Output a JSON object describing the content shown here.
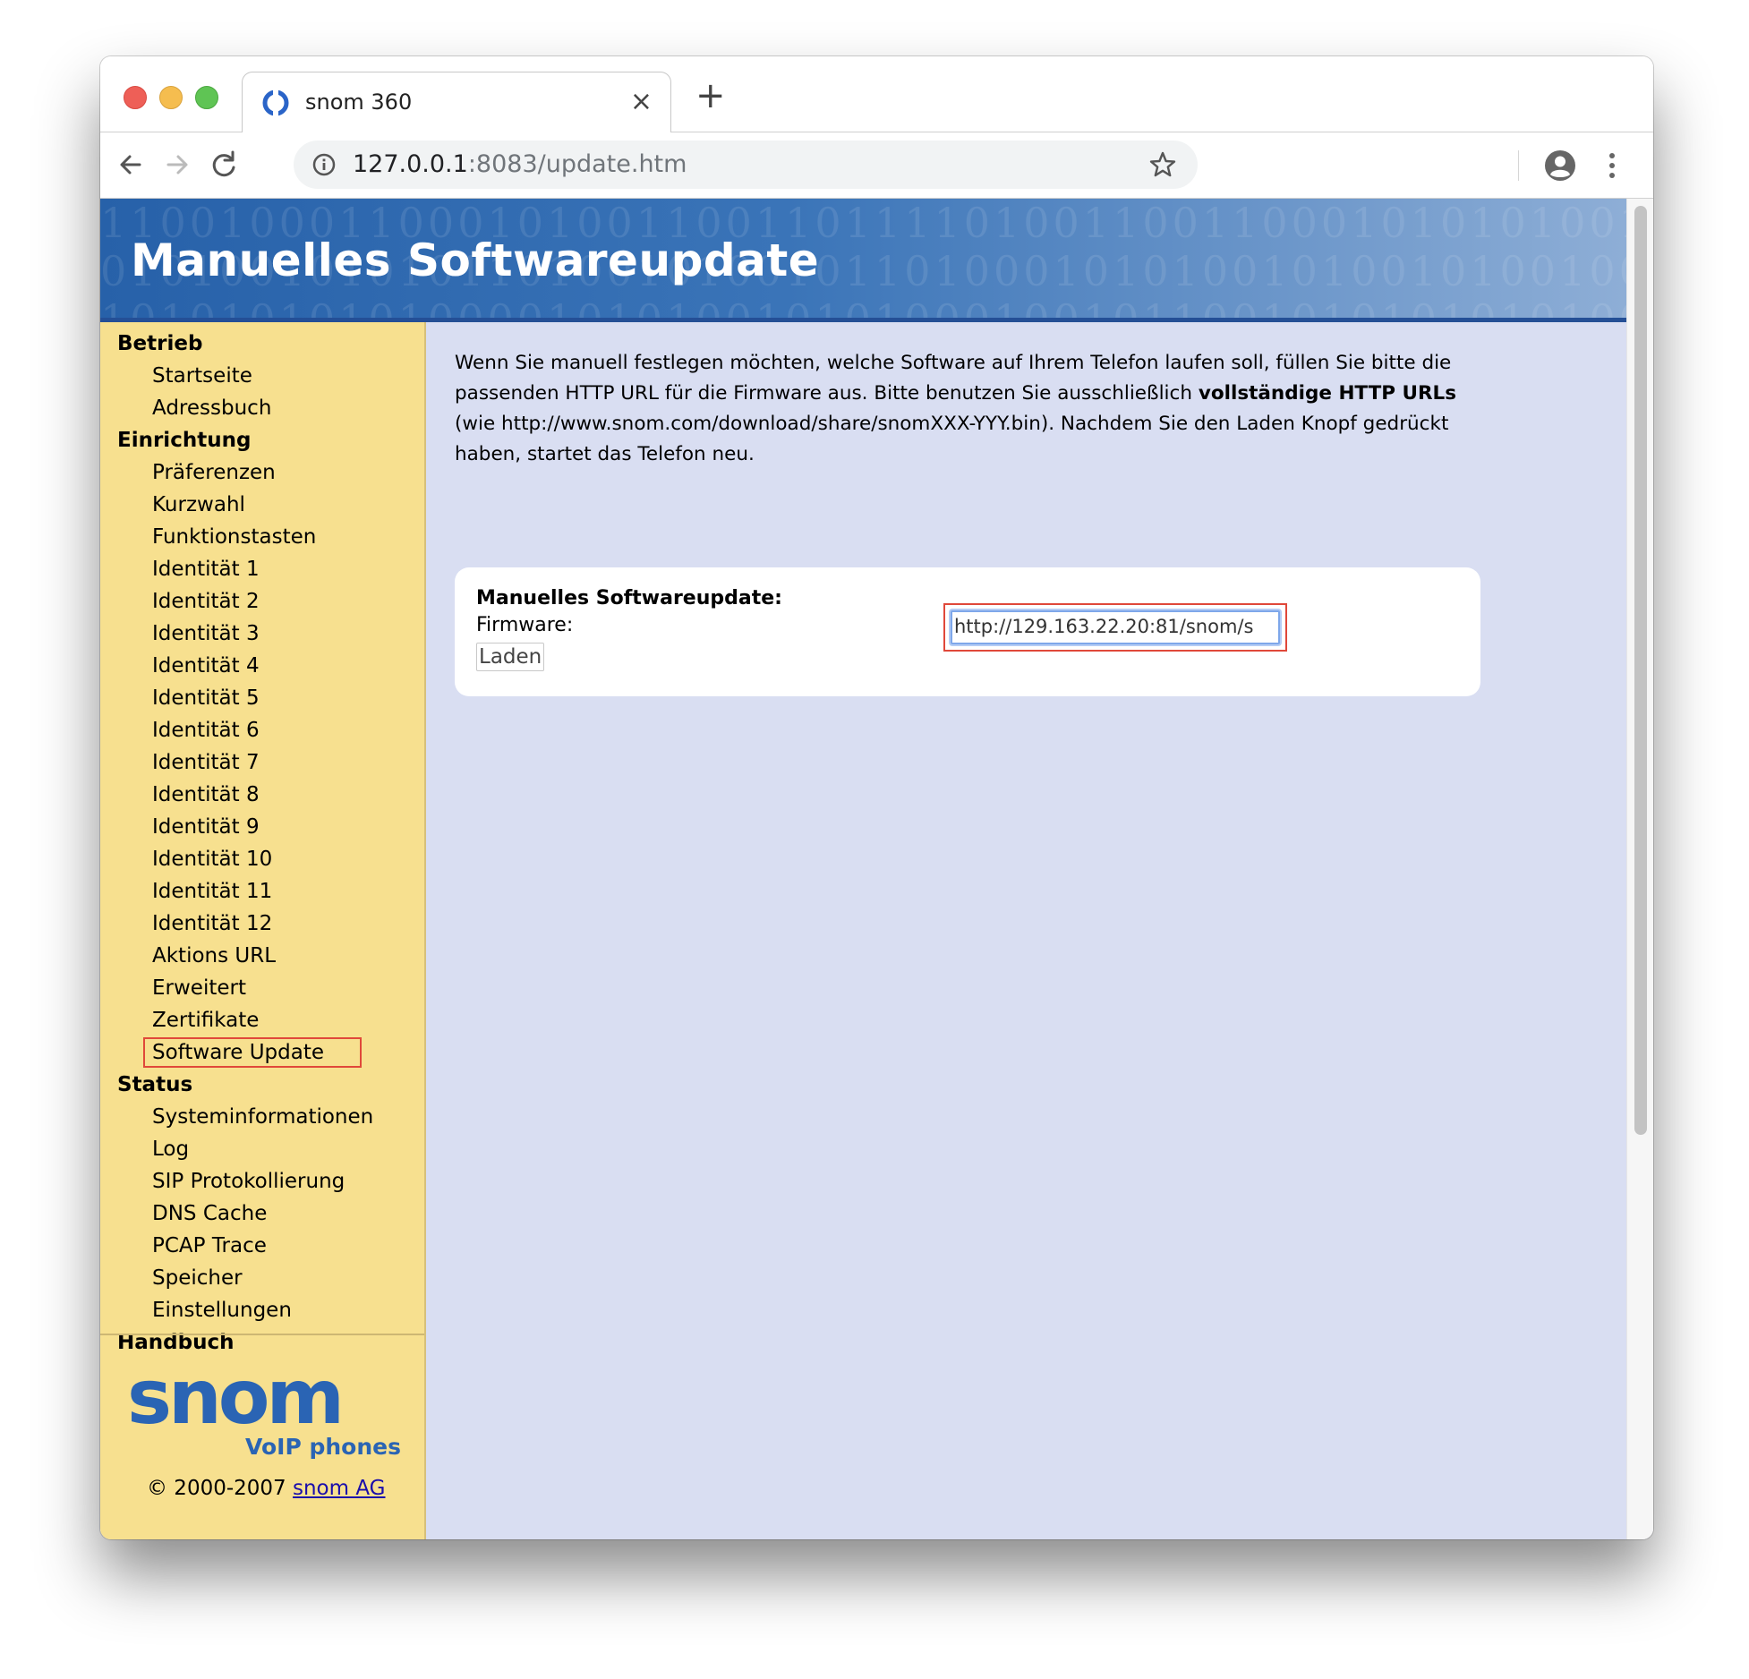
{
  "browser": {
    "tab_title": "snom 360",
    "tab_close": "×",
    "new_tab": "+",
    "url_host": "127.0.0.1",
    "url_rest": ":8083/update.htm"
  },
  "banner": {
    "title": "Manuelles Softwareupdate"
  },
  "sidebar": {
    "sections": [
      {
        "header": "Betrieb",
        "items": [
          "Startseite",
          "Adressbuch"
        ]
      },
      {
        "header": "Einrichtung",
        "items": [
          "Präferenzen",
          "Kurzwahl",
          "Funktionstasten",
          "Identität 1",
          "Identität 2",
          "Identität 3",
          "Identität 4",
          "Identität 5",
          "Identität 6",
          "Identität 7",
          "Identität 8",
          "Identität 9",
          "Identität 10",
          "Identität 11",
          "Identität 12",
          "Aktions URL",
          "Erweitert",
          "Zertifikate",
          "Software Update"
        ]
      },
      {
        "header": "Status",
        "items": [
          "Systeminformationen",
          "Log",
          "SIP Protokollierung",
          "DNS Cache",
          "PCAP Trace",
          "Speicher",
          "Einstellungen"
        ]
      },
      {
        "header": "Handbuch",
        "items": []
      }
    ],
    "active_item": "Software Update",
    "logo_text": "snom",
    "logo_sub": "VoIP phones",
    "copyright_prefix": "© 2000-2007 ",
    "copyright_link": "snom AG"
  },
  "main": {
    "intro_1": "Wenn Sie manuell festlegen möchten, welche Software auf Ihrem Telefon laufen soll, füllen Sie bitte die passenden HTTP URL für die Firmware aus. Bitte benutzen Sie ausschließlich ",
    "intro_bold": "vollständige HTTP URLs",
    "intro_2": " (wie http://www.snom.com/download/share/snomXXX-YYY.bin). Nachdem Sie den Laden Knopf gedrückt haben, startet das Telefon neu.",
    "panel_title": "Manuelles Softwareupdate:",
    "firmware_label": "Firmware:",
    "firmware_value": "http://129.163.22.20:81/snom/s",
    "load_button": "Laden"
  },
  "colors": {
    "sidebar_bg": "#f7e08f",
    "content_bg": "#d9def2",
    "banner_blue": "#2761a9",
    "highlight_red": "#e0483a",
    "logo_blue": "#2a64b4"
  }
}
